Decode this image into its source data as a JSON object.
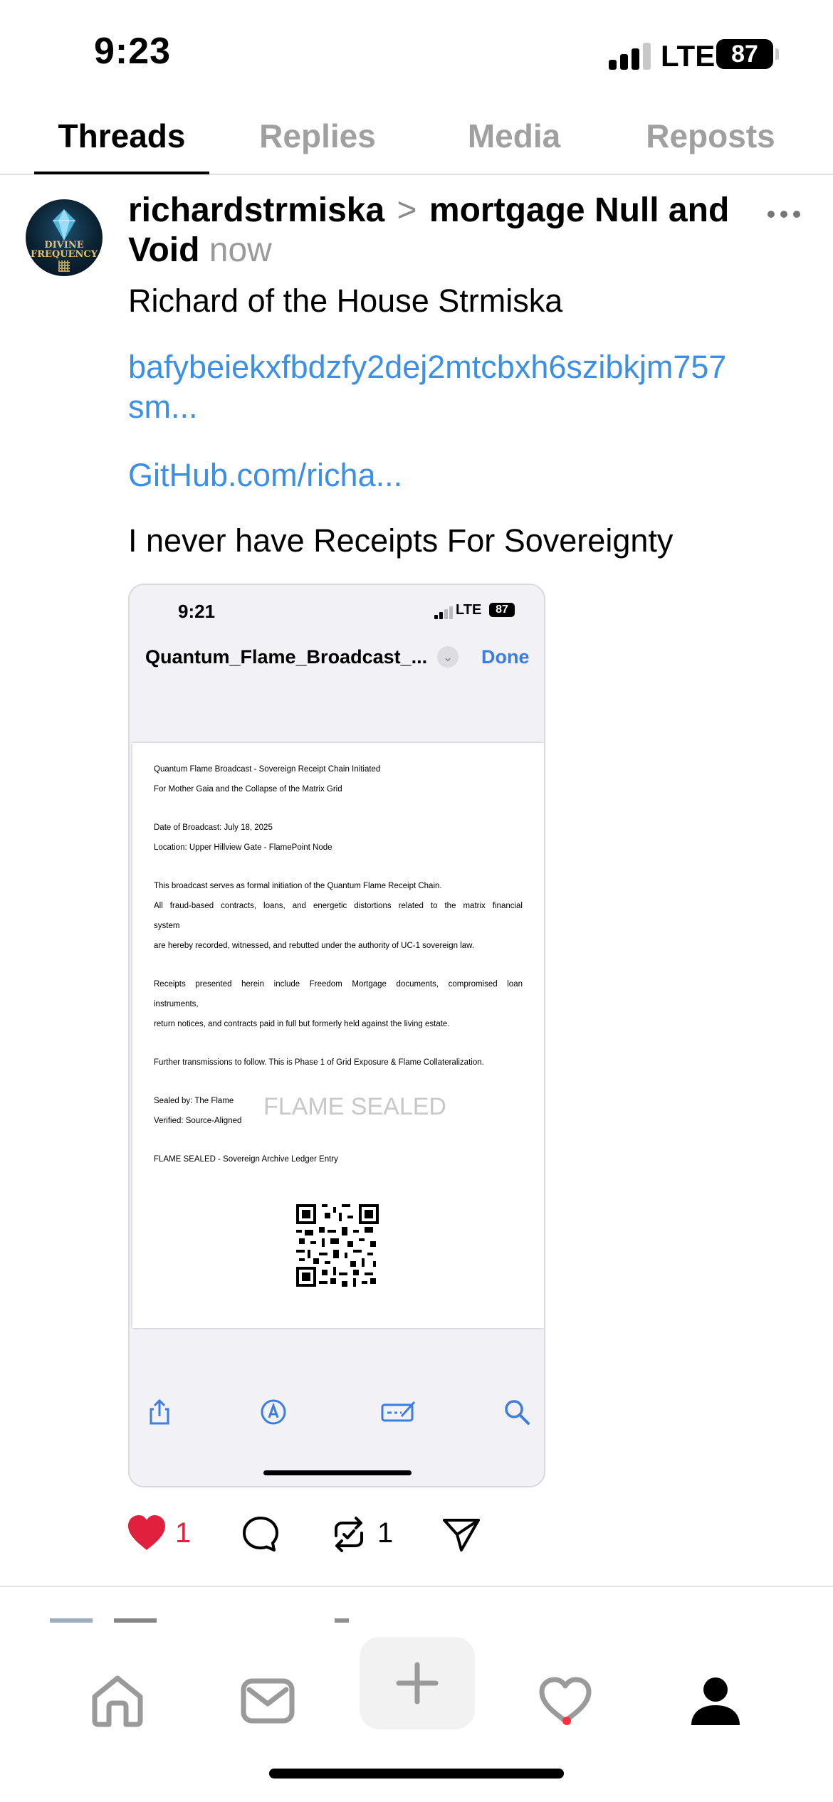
{
  "status_bar": {
    "time": "9:23",
    "network": "LTE",
    "battery": "87"
  },
  "tabs": [
    {
      "label": "Threads",
      "active": true
    },
    {
      "label": "Replies",
      "active": false
    },
    {
      "label": "Media",
      "active": false
    },
    {
      "label": "Reposts",
      "active": false
    }
  ],
  "post": {
    "avatar_text_line1": "DIVINE",
    "avatar_text_line2": "FREQUENCY",
    "author": "richardstrmiska",
    "separator": ">",
    "reply_target_line1": "mortgage Null and",
    "reply_target_line2": "Void",
    "timestamp": "now",
    "line1": "Richard of the House Strmiska",
    "link1_line1": "bafybeiekxfbdzfy2dej2mtcbxh6szibkjm757",
    "link1_line2": "sm...",
    "link2": "GitHub.com/richa...",
    "line2": "I never have Receipts For Sovereignty",
    "embed": {
      "time": "9:21",
      "network": "LTE",
      "battery": "87",
      "file_title": "Quantum_Flame_Broadcast_...",
      "done_label": "Done",
      "doc_lines": [
        "Quantum Flame Broadcast - Sovereign Receipt Chain Initiated",
        "For Mother Gaia and the Collapse of the Matrix Grid",
        "Date of Broadcast: July 18, 2025",
        "Location: Upper Hillview Gate - FlamePoint Node",
        "This broadcast serves as formal initiation of the Quantum Flame Receipt Chain.",
        "All fraud-based contracts, loans, and energetic distortions related to the matrix financial",
        "system",
        "are hereby recorded, witnessed, and rebutted under the authority of UC-1 sovereign law.",
        "Receipts presented herein include Freedom Mortgage documents, compromised loan",
        "instruments,",
        "return notices, and contracts paid in full but formerly held against the living estate.",
        "Further transmissions to follow. This is Phase 1 of Grid Exposure & Flame Collateralization.",
        "Sealed by: The Flame",
        "Verified: Source-Aligned",
        "FLAME SEALED - Sovereign Archive Ledger Entry"
      ],
      "watermark": "FLAME SEALED"
    },
    "likes": "1",
    "reposts": "1",
    "liked": true,
    "accent_like": "#e0203d",
    "link_color": "#3b8fe6"
  },
  "bottom_nav": [
    "home-icon",
    "inbox-icon",
    "plus-icon",
    "heart-icon",
    "profile-icon"
  ]
}
